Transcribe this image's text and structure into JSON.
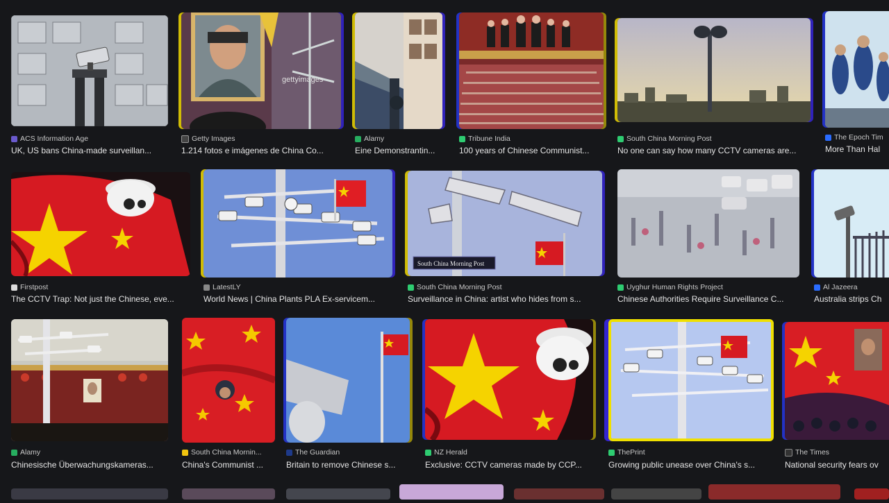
{
  "results": [
    {
      "source": "ACS Information Age",
      "title": "UK, US bans China-made surveillan...",
      "favicon_color": "#6a5acd"
    },
    {
      "source": "Getty Images",
      "title": "1.214 fotos e imágenes de China Co...",
      "favicon_color": "#444444"
    },
    {
      "source": "Alamy",
      "title": "Eine Demonstrantin...",
      "favicon_color": "#27ae60"
    },
    {
      "source": "Tribune India",
      "title": "100 years of Chinese Communist...",
      "favicon_color": "#2ecc71"
    },
    {
      "source": "South China Morning Post",
      "title": "No one can say how many CCTV cameras are...",
      "favicon_color": "#2ecc71"
    },
    {
      "source": "The Epoch Tim",
      "title": "More Than Hal",
      "favicon_color": "#2a6cff"
    },
    {
      "source": "Firstpost",
      "title": "The CCTV Trap: Not just the Chinese, eve...",
      "favicon_color": "#dddddd"
    },
    {
      "source": "LatestLY",
      "title": "World News | China Plants PLA Ex-servicem...",
      "favicon_color": "#888888"
    },
    {
      "source": "South China Morning Post",
      "title": "Surveillance in China: artist who hides from s...",
      "favicon_color": "#2ecc71"
    },
    {
      "source": "Uyghur Human Rights Project",
      "title": "Chinese Authorities Require Surveillance C...",
      "favicon_color": "#2ecc71"
    },
    {
      "source": "Al Jazeera",
      "title": "Australia strips Ch",
      "favicon_color": "#2a6cff"
    },
    {
      "source": "Alamy",
      "title": "Chinesische Überwachungskameras...",
      "favicon_color": "#27ae60"
    },
    {
      "source": "South China Mornin...",
      "title": "China's Communist ...",
      "favicon_color": "#f1c40f"
    },
    {
      "source": "The Guardian",
      "title": "Britain to remove Chinese s...",
      "favicon_color": "#1e3a8a"
    },
    {
      "source": "NZ Herald",
      "title": "Exclusive: CCTV cameras made by CCP...",
      "favicon_color": "#2ecc71"
    },
    {
      "source": "ThePrint",
      "title": "Growing public unease over China's s...",
      "favicon_color": "#2ecc71"
    },
    {
      "source": "The Times",
      "title": "National security fears ov",
      "favicon_color": "#333333"
    }
  ],
  "thumbs": {
    "getty_watermark": "gettyimages",
    "scmp_badge": "South China Morning Post"
  }
}
